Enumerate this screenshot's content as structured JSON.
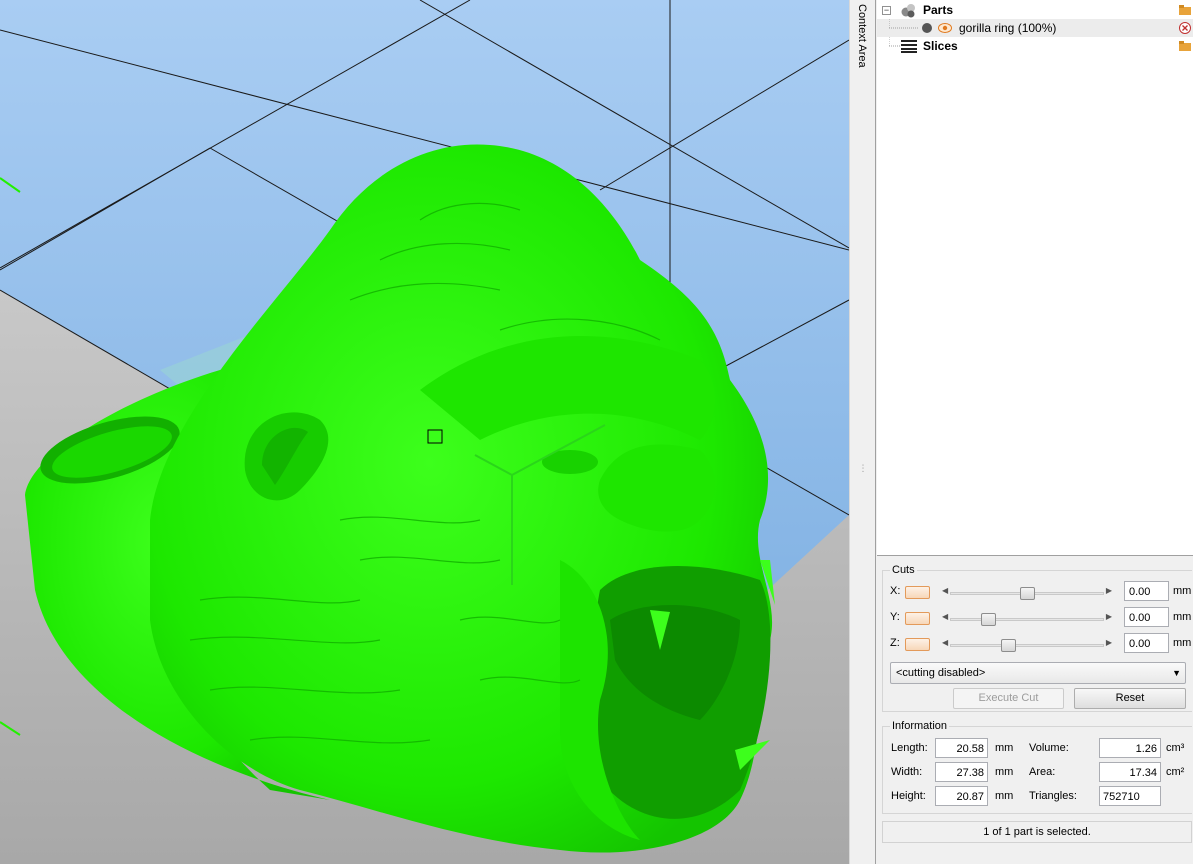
{
  "context_area": {
    "label": "Context Area"
  },
  "tree": {
    "parts": {
      "label": "Parts"
    },
    "part": {
      "label": "gorilla ring (100%)"
    },
    "slices": {
      "label": "Slices"
    }
  },
  "cuts": {
    "title": "Cuts",
    "unit": "mm",
    "axes": [
      {
        "label": "X:",
        "value": "0.00",
        "slider_position": 0.5
      },
      {
        "label": "Y:",
        "value": "0.00",
        "slider_position": 0.22
      },
      {
        "label": "Z:",
        "value": "0.00",
        "slider_position": 0.37
      }
    ],
    "mode": "<cutting disabled>",
    "execute_label": "Execute Cut",
    "reset_label": "Reset"
  },
  "information": {
    "title": "Information",
    "length_label": "Length:",
    "length_value": "20.58",
    "length_unit": "mm",
    "width_label": "Width:",
    "width_value": "27.38",
    "width_unit": "mm",
    "height_label": "Height:",
    "height_value": "20.87",
    "height_unit": "mm",
    "volume_label": "Volume:",
    "volume_value": "1.26",
    "volume_unit": "cm³",
    "area_label": "Area:",
    "area_value": "17.34",
    "area_unit": "cm²",
    "triangles_label": "Triangles:",
    "triangles_value": "752710"
  },
  "status": {
    "text": "1 of 1 part is selected."
  },
  "colors": {
    "model": "#22f000",
    "platform_sky": "#8fb9e8",
    "floor": "#c8c8c8",
    "accent": "#e39a5a"
  },
  "icons": {
    "parts": "parts-icon",
    "visible": "eye-icon",
    "remove": "remove-icon",
    "slices": "slices-icon",
    "folder": "folder-icon"
  }
}
